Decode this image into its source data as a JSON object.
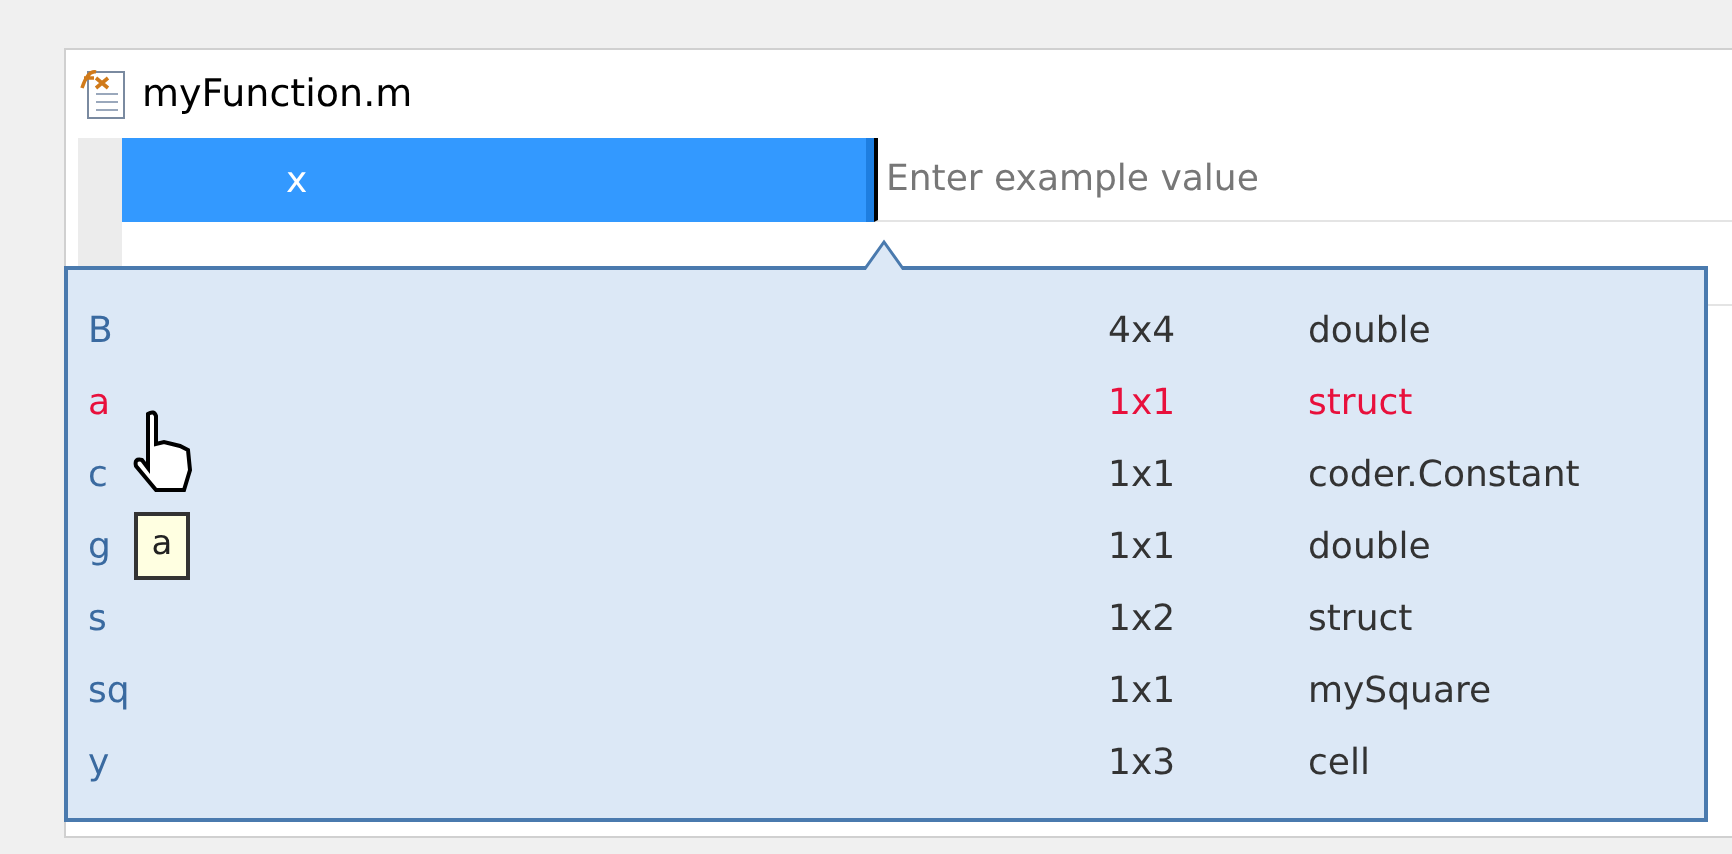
{
  "file": {
    "title": "myFunction.m"
  },
  "inputs": [
    {
      "name": "x",
      "placeholder": "Enter example value",
      "selected": true
    }
  ],
  "popup": {
    "items": [
      {
        "name": "B",
        "size": "4x4",
        "class": "double",
        "selected": false
      },
      {
        "name": "a",
        "size": "1x1",
        "class": "struct",
        "selected": true
      },
      {
        "name": "c",
        "size": "1x1",
        "class": "coder.Constant",
        "selected": false
      },
      {
        "name": "g",
        "size": "1x1",
        "class": "double",
        "selected": false
      },
      {
        "name": "s",
        "size": "1x2",
        "class": "struct",
        "selected": false
      },
      {
        "name": "sq",
        "size": "1x1",
        "class": "mySquare",
        "selected": false
      },
      {
        "name": "y",
        "size": "1x3",
        "class": "cell",
        "selected": false
      }
    ]
  },
  "tooltip": "a"
}
